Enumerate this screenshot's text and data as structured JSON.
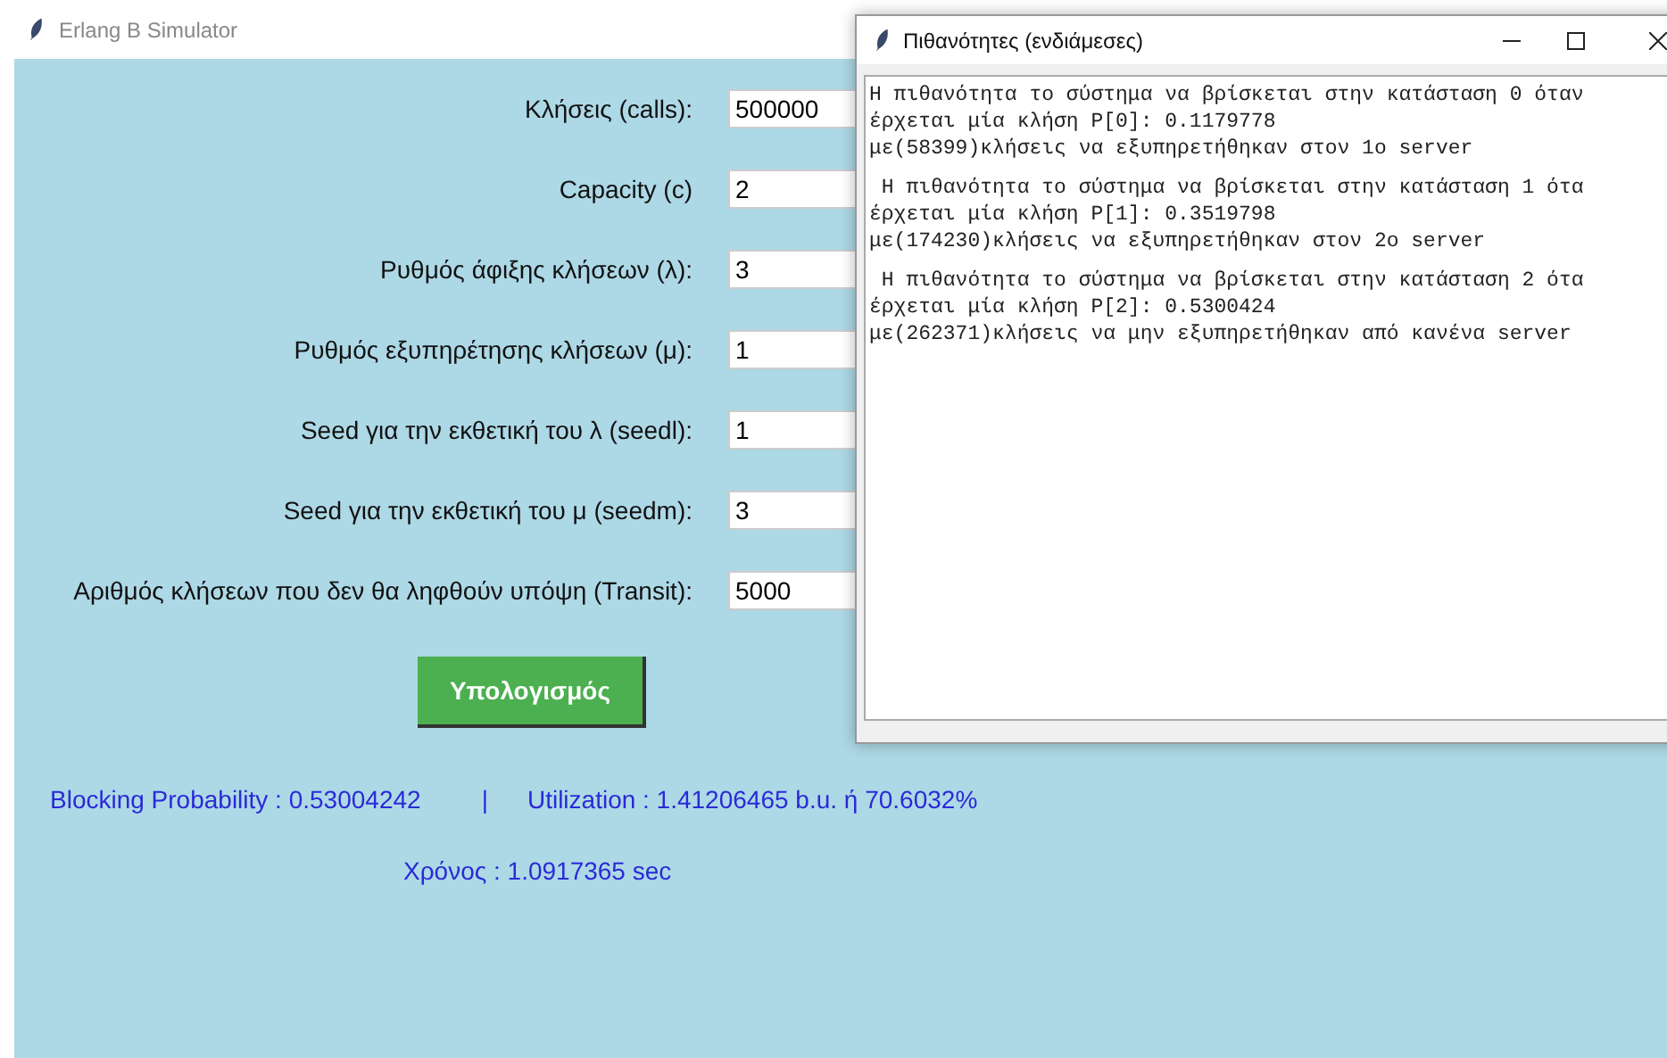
{
  "window": {
    "title": "Erlang B Simulator"
  },
  "fields": [
    {
      "label": "Κλήσεις (calls):",
      "value": "500000"
    },
    {
      "label": "Capacity (c)",
      "value": "2"
    },
    {
      "label": "Ρυθμός άφιξης κλήσεων (λ):",
      "value": "3"
    },
    {
      "label": "Ρυθμός εξυπηρέτησης κλήσεων (μ):",
      "value": "1"
    },
    {
      "label": "Seed για την εκθετική του λ (seedl):",
      "value": "1"
    },
    {
      "label": "Seed για την εκθετική του μ (seedm):",
      "value": "3"
    },
    {
      "label": "Αριθμός κλήσεων που δεν θα ληφθούν υπόψη (Transit):",
      "value": "5000"
    }
  ],
  "calculate_button": "Υπολογισμός",
  "results": {
    "blocking": "Blocking Probability : 0.53004242",
    "separator": "|",
    "utilization": "Utilization : 1.41206465 b.u. ή 70.6032%",
    "time": "Χρόνος : 1.0917365 sec"
  },
  "popup": {
    "title": "Πιθανότητες (ενδιάμεσες)",
    "blocks": [
      [
        "Η πιθανότητα το σύστημα να βρίσκεται στην κατάσταση 0 όταν",
        "έρχεται μία κλήση P[0]: 0.1179778",
        "με(58399)κλήσεις να εξυπηρετήθηκαν στον 1ο server"
      ],
      [
        " Η πιθανότητα το σύστημα να βρίσκεται στην κατάσταση 1 ότα",
        "έρχεται μία κλήση P[1]: 0.3519798",
        "με(174230)κλήσεις να εξυπηρετήθηκαν στον 2ο server"
      ],
      [
        " Η πιθανότητα το σύστημα να βρίσκεται στην κατάσταση 2 ότα",
        "έρχεται μία κλήση P[2]: 0.5300424",
        "με(262371)κλήσεις να μην εξυπηρετήθηκαν από κανένα server"
      ]
    ]
  }
}
